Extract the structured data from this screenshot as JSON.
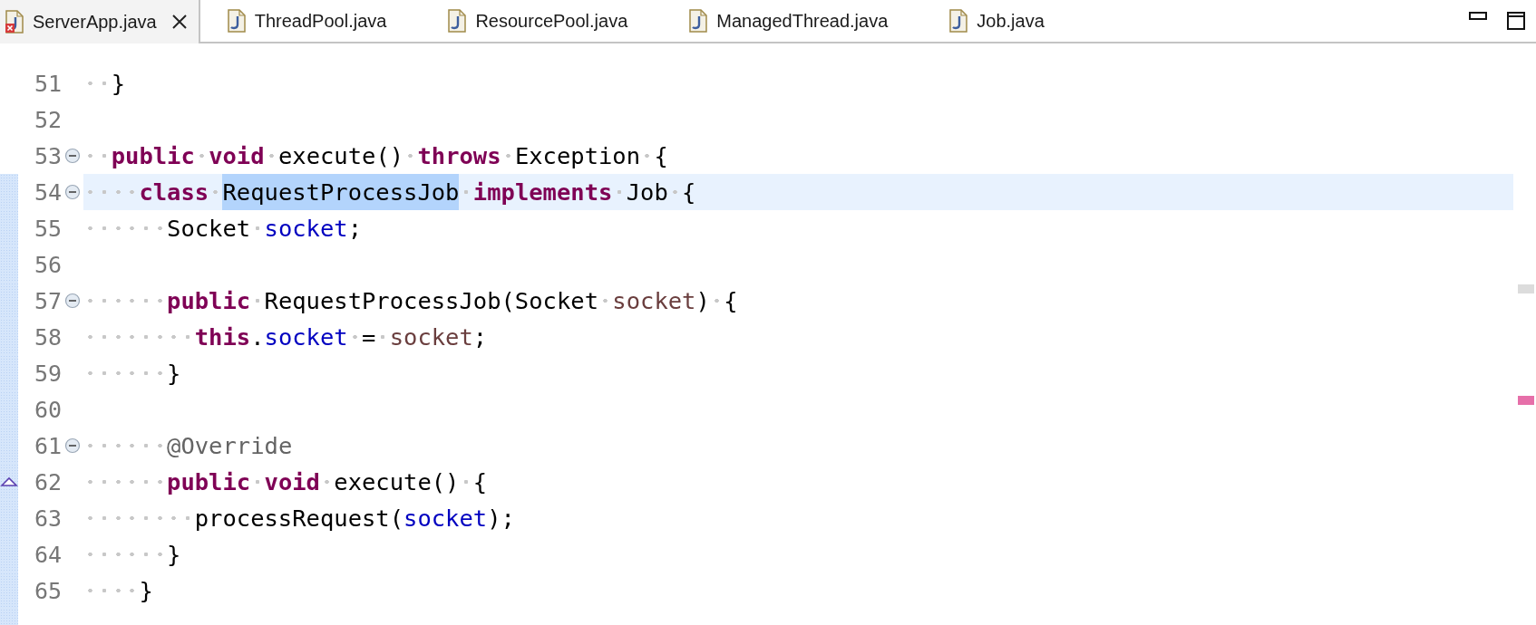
{
  "tabs": [
    {
      "label": "ServerApp.java",
      "selected": true,
      "error": true
    },
    {
      "label": "ThreadPool.java",
      "selected": false,
      "error": false
    },
    {
      "label": "ResourcePool.java",
      "selected": false,
      "error": false
    },
    {
      "label": "ManagedThread.java",
      "selected": false,
      "error": false
    },
    {
      "label": "Job.java",
      "selected": false,
      "error": false
    }
  ],
  "editor": {
    "lines": [
      {
        "number": "51",
        "fold": false,
        "current": false,
        "changed": false,
        "tokens": [
          {
            "kind": "plain",
            "text": "  }"
          }
        ]
      },
      {
        "number": "52",
        "fold": false,
        "current": false,
        "changed": false
      },
      {
        "number": "53",
        "fold": true,
        "current": false,
        "changed": false,
        "tokens": [
          {
            "kind": "keyword",
            "text": "  public void"
          },
          {
            "kind": "plain",
            "text": " execute() "
          },
          {
            "kind": "keyword",
            "text": "throws"
          },
          {
            "kind": "plain",
            "text": " Exception {"
          }
        ]
      },
      {
        "number": "54",
        "fold": true,
        "current": true,
        "changed": true,
        "tokens": [
          {
            "kind": "keyword",
            "text": "    class "
          },
          {
            "kind": "selected",
            "text": "RequestProcessJob"
          },
          {
            "kind": "keyword",
            "text": " implements"
          },
          {
            "kind": "plain",
            "text": " Job {"
          }
        ]
      },
      {
        "number": "55",
        "fold": false,
        "current": false,
        "changed": true,
        "tokens": [
          {
            "kind": "plain",
            "text": "      Socket "
          },
          {
            "kind": "field",
            "text": "socket"
          },
          {
            "kind": "plain",
            "text": ";"
          }
        ]
      },
      {
        "number": "56",
        "fold": false,
        "current": false,
        "changed": true
      },
      {
        "number": "57",
        "fold": true,
        "current": false,
        "changed": true,
        "tokens": [
          {
            "kind": "keyword",
            "text": "      public"
          },
          {
            "kind": "plain",
            "text": " RequestProcessJob(Socket "
          },
          {
            "kind": "param",
            "text": "socket"
          },
          {
            "kind": "plain",
            "text": ") {"
          }
        ]
      },
      {
        "number": "58",
        "fold": false,
        "current": false,
        "changed": true,
        "tokens": [
          {
            "kind": "keyword",
            "text": "        this"
          },
          {
            "kind": "plain",
            "text": "."
          },
          {
            "kind": "field",
            "text": "socket"
          },
          {
            "kind": "plain",
            "text": " = "
          },
          {
            "kind": "param",
            "text": "socket"
          },
          {
            "kind": "plain",
            "text": ";"
          }
        ]
      },
      {
        "number": "59",
        "fold": false,
        "current": false,
        "changed": true,
        "tokens": [
          {
            "kind": "plain",
            "text": "      }"
          }
        ]
      },
      {
        "number": "60",
        "fold": false,
        "current": false,
        "changed": true
      },
      {
        "number": "61",
        "fold": true,
        "current": false,
        "changed": true,
        "tokens": [
          {
            "kind": "annotation",
            "text": "      @Override"
          }
        ]
      },
      {
        "number": "62",
        "fold": false,
        "current": false,
        "changed": true,
        "override": true,
        "tokens": [
          {
            "kind": "keyword",
            "text": "      public void"
          },
          {
            "kind": "plain",
            "text": " execute() {"
          }
        ]
      },
      {
        "number": "63",
        "fold": false,
        "current": false,
        "changed": true,
        "tokens": [
          {
            "kind": "plain",
            "text": "        processRequest("
          },
          {
            "kind": "field",
            "text": "socket"
          },
          {
            "kind": "plain",
            "text": ");"
          }
        ]
      },
      {
        "number": "64",
        "fold": false,
        "current": false,
        "changed": true,
        "tokens": [
          {
            "kind": "plain",
            "text": "      }"
          }
        ]
      },
      {
        "number": "65",
        "fold": false,
        "current": false,
        "changed": true,
        "tokens": [
          {
            "kind": "plain",
            "text": "    }"
          }
        ]
      }
    ],
    "overview_marks": [
      {
        "color": "#dcdcdc"
      },
      {
        "color": "#e66fa9"
      }
    ]
  }
}
